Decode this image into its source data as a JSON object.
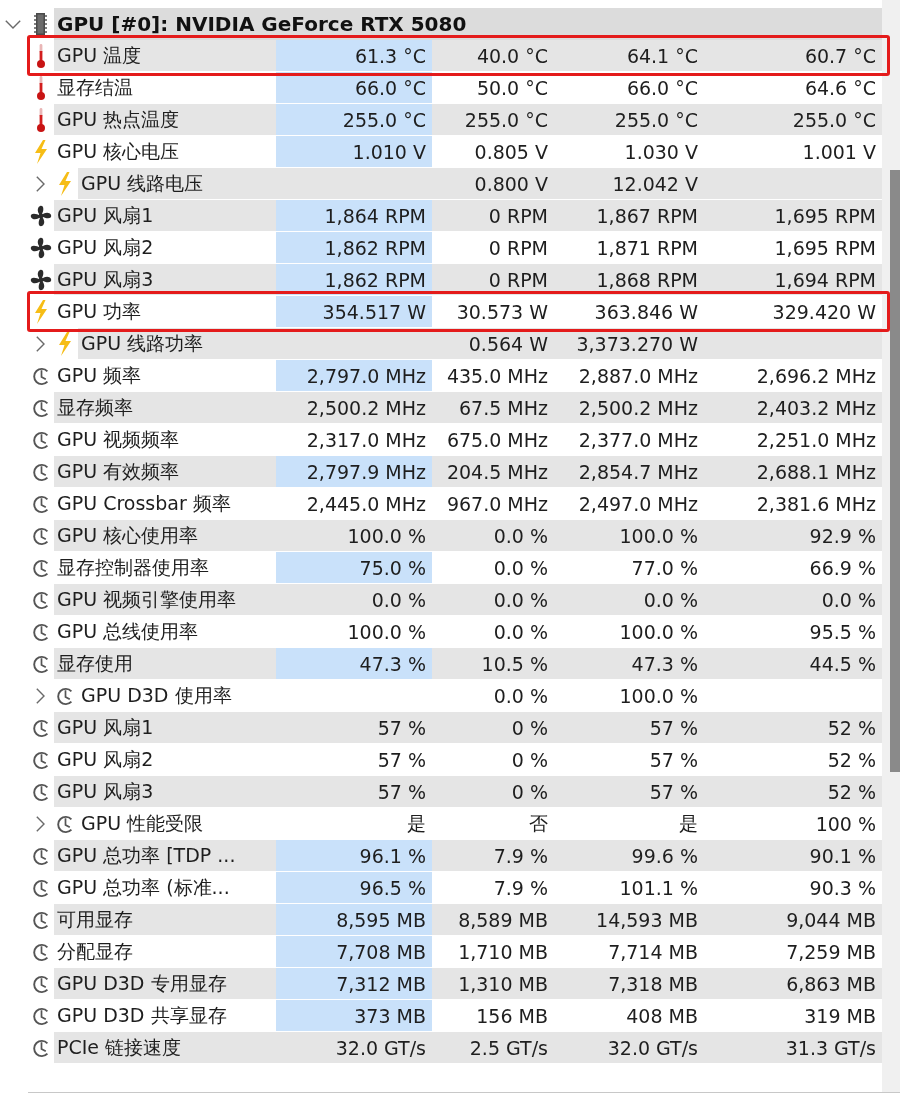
{
  "sensor_tree": {
    "device": {
      "label": "GPU [#0]: NVIDIA GeForce RTX 5080",
      "expanded": true,
      "children": [
        {
          "kind": "temperature",
          "label": "GPU 温度",
          "values": {
            "column_1": "61.3 °C",
            "column_2": "40.0 °C",
            "column_3": "64.1 °C",
            "column_4": "60.7 °C"
          },
          "highlighted": true,
          "shaded": true,
          "outlined": true
        },
        {
          "kind": "temperature",
          "label": "显存结温",
          "values": {
            "column_1": "66.0 °C",
            "column_2": "50.0 °C",
            "column_3": "66.0 °C",
            "column_4": "64.6 °C"
          },
          "highlighted": true,
          "shaded": false,
          "outlined": false
        },
        {
          "kind": "temperature",
          "label": "GPU 热点温度",
          "values": {
            "column_1": "255.0 °C",
            "column_2": "255.0 °C",
            "column_3": "255.0 °C",
            "column_4": "255.0 °C"
          },
          "highlighted": true,
          "shaded": true,
          "outlined": false
        },
        {
          "kind": "voltage",
          "label": "GPU 核心电压",
          "values": {
            "column_1": "1.010 V",
            "column_2": "0.805 V",
            "column_3": "1.030 V",
            "column_4": "1.001 V"
          },
          "highlighted": true,
          "shaded": false,
          "outlined": false
        },
        {
          "kind": "voltage",
          "label": "GPU 线路电压",
          "expanded": false,
          "values": {
            "column_2": "0.800 V",
            "column_3": "12.042 V"
          },
          "highlighted": false,
          "shaded": true,
          "outlined": false
        },
        {
          "kind": "fan",
          "label": "GPU 风扇1",
          "values": {
            "column_1": "1,864 RPM",
            "column_2": "0 RPM",
            "column_3": "1,867 RPM",
            "column_4": "1,695 RPM"
          },
          "highlighted": true,
          "shaded": true,
          "outlined": false
        },
        {
          "kind": "fan",
          "label": "GPU 风扇2",
          "values": {
            "column_1": "1,862 RPM",
            "column_2": "0 RPM",
            "column_3": "1,871 RPM",
            "column_4": "1,695 RPM"
          },
          "highlighted": true,
          "shaded": false,
          "outlined": false
        },
        {
          "kind": "fan",
          "label": "GPU 风扇3",
          "values": {
            "column_1": "1,862 RPM",
            "column_2": "0 RPM",
            "column_3": "1,868 RPM",
            "column_4": "1,694 RPM"
          },
          "highlighted": true,
          "shaded": true,
          "outlined": false
        },
        {
          "kind": "power",
          "label": "GPU 功率",
          "values": {
            "column_1": "354.517 W",
            "column_2": "30.573 W",
            "column_3": "363.846 W",
            "column_4": "329.420 W"
          },
          "highlighted": true,
          "shaded": false,
          "outlined": true
        },
        {
          "kind": "power",
          "label": "GPU 线路功率",
          "expanded": false,
          "values": {
            "column_2": "0.564 W",
            "column_3": "3,373.270 W"
          },
          "highlighted": false,
          "shaded": true,
          "outlined": false
        },
        {
          "kind": "other",
          "label": "GPU 频率",
          "values": {
            "column_1": "2,797.0 MHz",
            "column_2": "435.0 MHz",
            "column_3": "2,887.0 MHz",
            "column_4": "2,696.2 MHz"
          },
          "highlighted": true,
          "shaded": false,
          "outlined": false
        },
        {
          "kind": "other",
          "label": "显存频率",
          "values": {
            "column_1": "2,500.2 MHz",
            "column_2": "67.5 MHz",
            "column_3": "2,500.2 MHz",
            "column_4": "2,403.2 MHz"
          },
          "highlighted": false,
          "shaded": true,
          "outlined": false
        },
        {
          "kind": "other",
          "label": "GPU 视频频率",
          "values": {
            "column_1": "2,317.0 MHz",
            "column_2": "675.0 MHz",
            "column_3": "2,377.0 MHz",
            "column_4": "2,251.0 MHz"
          },
          "highlighted": false,
          "shaded": false,
          "outlined": false
        },
        {
          "kind": "other",
          "label": "GPU 有效频率",
          "values": {
            "column_1": "2,797.9 MHz",
            "column_2": "204.5 MHz",
            "column_3": "2,854.7 MHz",
            "column_4": "2,688.1 MHz"
          },
          "highlighted": true,
          "shaded": true,
          "outlined": false
        },
        {
          "kind": "other",
          "label": "GPU Crossbar 频率",
          "values": {
            "column_1": "2,445.0 MHz",
            "column_2": "967.0 MHz",
            "column_3": "2,497.0 MHz",
            "column_4": "2,381.6 MHz"
          },
          "highlighted": false,
          "shaded": false,
          "outlined": false
        },
        {
          "kind": "other",
          "label": "GPU 核心使用率",
          "values": {
            "column_1": "100.0 %",
            "column_2": "0.0 %",
            "column_3": "100.0 %",
            "column_4": "92.9 %"
          },
          "highlighted": false,
          "shaded": true,
          "outlined": false
        },
        {
          "kind": "other",
          "label": "显存控制器使用率",
          "values": {
            "column_1": "75.0 %",
            "column_2": "0.0 %",
            "column_3": "77.0 %",
            "column_4": "66.9 %"
          },
          "highlighted": true,
          "shaded": false,
          "outlined": false
        },
        {
          "kind": "other",
          "label": "GPU 视频引擎使用率",
          "values": {
            "column_1": "0.0 %",
            "column_2": "0.0 %",
            "column_3": "0.0 %",
            "column_4": "0.0 %"
          },
          "highlighted": false,
          "shaded": true,
          "outlined": false
        },
        {
          "kind": "other",
          "label": "GPU 总线使用率",
          "values": {
            "column_1": "100.0 %",
            "column_2": "0.0 %",
            "column_3": "100.0 %",
            "column_4": "95.5 %"
          },
          "highlighted": false,
          "shaded": false,
          "outlined": false
        },
        {
          "kind": "other",
          "label": "显存使用",
          "values": {
            "column_1": "47.3 %",
            "column_2": "10.5 %",
            "column_3": "47.3 %",
            "column_4": "44.5 %"
          },
          "highlighted": true,
          "shaded": true,
          "outlined": false
        },
        {
          "kind": "other",
          "label": "GPU D3D 使用率",
          "expanded": false,
          "values": {
            "column_2": "0.0 %",
            "column_3": "100.0 %"
          },
          "highlighted": false,
          "shaded": false,
          "outlined": false
        },
        {
          "kind": "other",
          "label": "GPU 风扇1",
          "values": {
            "column_1": "57 %",
            "column_2": "0 %",
            "column_3": "57 %",
            "column_4": "52 %"
          },
          "highlighted": false,
          "shaded": true,
          "outlined": false
        },
        {
          "kind": "other",
          "label": "GPU 风扇2",
          "values": {
            "column_1": "57 %",
            "column_2": "0 %",
            "column_3": "57 %",
            "column_4": "52 %"
          },
          "highlighted": false,
          "shaded": false,
          "outlined": false
        },
        {
          "kind": "other",
          "label": "GPU 风扇3",
          "values": {
            "column_1": "57 %",
            "column_2": "0 %",
            "column_3": "57 %",
            "column_4": "52 %"
          },
          "highlighted": false,
          "shaded": true,
          "outlined": false
        },
        {
          "kind": "other",
          "label": "GPU 性能受限",
          "expanded": false,
          "values": {
            "column_1": "是",
            "column_2": "否",
            "column_3": "是",
            "column_4": "100 %"
          },
          "highlighted": false,
          "shaded": false,
          "outlined": false
        },
        {
          "kind": "other",
          "label": "GPU 总功率 [TDP ...",
          "values": {
            "column_1": "96.1 %",
            "column_2": "7.9 %",
            "column_3": "99.6 %",
            "column_4": "90.1 %"
          },
          "highlighted": true,
          "shaded": true,
          "outlined": false
        },
        {
          "kind": "other",
          "label": "GPU 总功率 (标准...",
          "values": {
            "column_1": "96.5 %",
            "column_2": "7.9 %",
            "column_3": "101.1 %",
            "column_4": "90.3 %"
          },
          "highlighted": true,
          "shaded": false,
          "outlined": false
        },
        {
          "kind": "other",
          "label": "可用显存",
          "values": {
            "column_1": "8,595 MB",
            "column_2": "8,589 MB",
            "column_3": "14,593 MB",
            "column_4": "9,044 MB"
          },
          "highlighted": true,
          "shaded": true,
          "outlined": false
        },
        {
          "kind": "other",
          "label": "分配显存",
          "values": {
            "column_1": "7,708 MB",
            "column_2": "1,710 MB",
            "column_3": "7,714 MB",
            "column_4": "7,259 MB"
          },
          "highlighted": true,
          "shaded": false,
          "outlined": false
        },
        {
          "kind": "other",
          "label": "GPU D3D 专用显存",
          "values": {
            "column_1": "7,312 MB",
            "column_2": "1,310 MB",
            "column_3": "7,318 MB",
            "column_4": "6,863 MB"
          },
          "highlighted": true,
          "shaded": true,
          "outlined": false
        },
        {
          "kind": "other",
          "label": "GPU D3D 共享显存",
          "values": {
            "column_1": "373 MB",
            "column_2": "156 MB",
            "column_3": "408 MB",
            "column_4": "319 MB"
          },
          "highlighted": true,
          "shaded": false,
          "outlined": false
        },
        {
          "kind": "other",
          "label": "PCIe 链接速度",
          "values": {
            "column_1": "32.0 GT/s",
            "column_2": "2.5 GT/s",
            "column_3": "32.0 GT/s",
            "column_4": "31.3 GT/s"
          },
          "highlighted": false,
          "shaded": true,
          "outlined": false
        }
      ]
    }
  }
}
